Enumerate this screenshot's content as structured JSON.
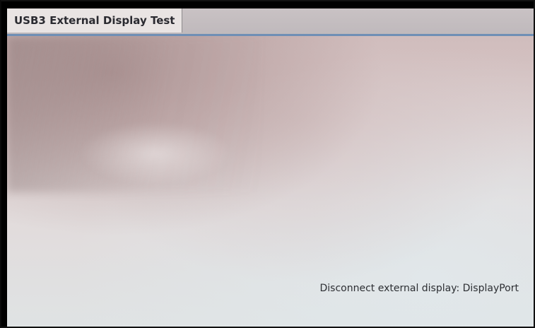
{
  "window": {
    "tab_title": "USB3 External Display Test"
  },
  "main": {
    "status_message": "Disconnect external display: DisplayPort"
  }
}
